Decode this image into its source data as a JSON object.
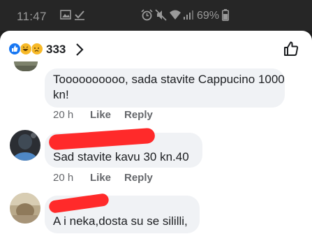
{
  "status_bar": {
    "time": "11:47",
    "battery_percent": "69%",
    "icons": [
      "image-icon",
      "checkbox-icon",
      "alarm-icon",
      "mute-icon",
      "wifi-icon",
      "signal-icon",
      "battery-icon"
    ]
  },
  "header": {
    "reaction_icons": [
      "like-reaction-icon",
      "haha-reaction-icon",
      "sad-reaction-icon"
    ],
    "reaction_count": "333",
    "chevron_icon": "chevron-right-icon",
    "like_icon": "thumbs-up-icon"
  },
  "comments": [
    {
      "text_lines": [
        "Toooooooooo, sada stavite Cappucino 1000",
        "kn!"
      ],
      "time": "20 h",
      "like": "Like",
      "reply": "Reply"
    },
    {
      "text": "Sad stavite kavu 30 kn.40",
      "time": "20 h",
      "like": "Like",
      "reply": "Reply"
    },
    {
      "text": "A i neka,dosta su se sililli,"
    }
  ],
  "colors": {
    "bubble": "#f0f2f5",
    "redaction": "#ff2a2a",
    "meta_text": "#65676b",
    "like_blue": "#1877f2"
  }
}
